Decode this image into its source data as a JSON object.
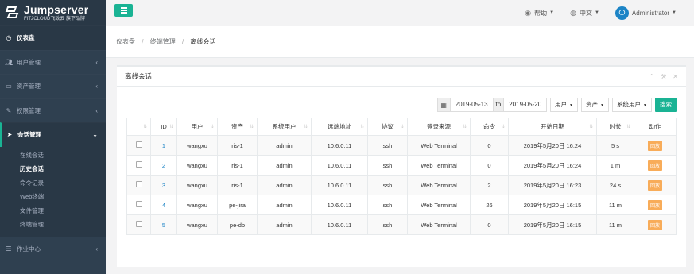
{
  "app": {
    "logo_title": "Jumpserver",
    "logo_sub": "FIT2CLOUD飞致云 旗下品牌"
  },
  "sidebar": {
    "items": [
      {
        "label": "仪表盘",
        "icon": "dashboard-icon"
      },
      {
        "label": "用户管理",
        "icon": "users-icon"
      },
      {
        "label": "资产管理",
        "icon": "inbox-icon"
      },
      {
        "label": "权限管理",
        "icon": "edit-icon"
      },
      {
        "label": "会话管理",
        "icon": "rocket-icon"
      },
      {
        "label": "作业中心",
        "icon": "list-icon"
      }
    ],
    "subitems": [
      "在线会话",
      "历史会话",
      "命令记录",
      "Web终端",
      "文件管理",
      "终端管理"
    ]
  },
  "topbar": {
    "help": "帮助",
    "lang": "中文",
    "user": "Administrator"
  },
  "breadcrumb": {
    "home": "仪表盘",
    "section": "终端管理",
    "current": "离线会话"
  },
  "panel": {
    "title": "离线会话"
  },
  "filters": {
    "date_from": "2019-05-13",
    "to": "to",
    "date_to": "2019-05-20",
    "user": "用户",
    "asset": "资产",
    "system_user": "系统用户",
    "search": "搜索"
  },
  "table": {
    "headers": [
      "ID",
      "用户",
      "资产",
      "系统用户",
      "远端地址",
      "协议",
      "登录来源",
      "命令",
      "开始日期",
      "时长",
      "动作"
    ],
    "rows": [
      {
        "id": "1",
        "user": "wangxu",
        "asset": "ris-1",
        "sysuser": "admin",
        "addr": "10.6.0.11",
        "proto": "ssh",
        "source": "Web Terminal",
        "cmds": "0",
        "start": "2019年5月20日 16:24",
        "dur": "5 s",
        "action": "回放"
      },
      {
        "id": "2",
        "user": "wangxu",
        "asset": "ris-1",
        "sysuser": "admin",
        "addr": "10.6.0.11",
        "proto": "ssh",
        "source": "Web Terminal",
        "cmds": "0",
        "start": "2019年5月20日 16:24",
        "dur": "1 m",
        "action": "回放"
      },
      {
        "id": "3",
        "user": "wangxu",
        "asset": "ris-1",
        "sysuser": "admin",
        "addr": "10.6.0.11",
        "proto": "ssh",
        "source": "Web Terminal",
        "cmds": "2",
        "start": "2019年5月20日 16:23",
        "dur": "24 s",
        "action": "回放"
      },
      {
        "id": "4",
        "user": "wangxu",
        "asset": "pe-jira",
        "sysuser": "admin",
        "addr": "10.6.0.11",
        "proto": "ssh",
        "source": "Web Terminal",
        "cmds": "26",
        "start": "2019年5月20日 16:15",
        "dur": "11 m",
        "action": "回放"
      },
      {
        "id": "5",
        "user": "wangxu",
        "asset": "pe-db",
        "sysuser": "admin",
        "addr": "10.6.0.11",
        "proto": "ssh",
        "source": "Web Terminal",
        "cmds": "0",
        "start": "2019年5月20日 16:15",
        "dur": "11 m",
        "action": "回放"
      }
    ]
  },
  "colors": {
    "accent": "#1ab394",
    "sidebar": "#2f4050",
    "link": "#1c84c6",
    "replay": "#f8ac59"
  }
}
